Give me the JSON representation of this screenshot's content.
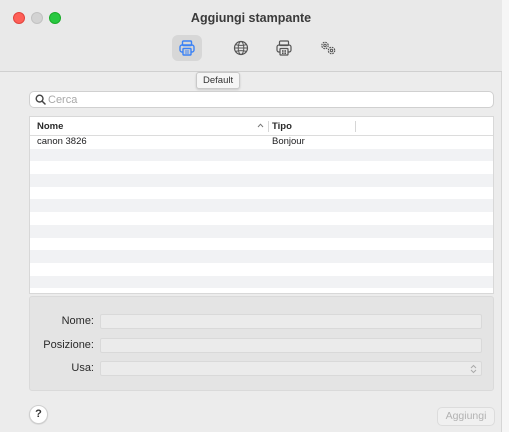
{
  "window": {
    "title": "Aggiungi stampante"
  },
  "toolbar": {
    "items": [
      {
        "name": "Default",
        "icon": "printer-icon",
        "active": true
      },
      {
        "name": "IP",
        "icon": "globe-icon",
        "active": false
      },
      {
        "name": "Windows",
        "icon": "windows-printer-icon",
        "active": false
      },
      {
        "name": "Avanzate",
        "icon": "gears-icon",
        "active": false
      }
    ],
    "tooltip": "Default"
  },
  "search": {
    "placeholder": "Cerca",
    "value": ""
  },
  "table": {
    "columns": [
      "Nome",
      "Tipo"
    ],
    "sort": {
      "column": "Nome",
      "direction": "ascending"
    },
    "rows": [
      {
        "name": "canon 3826",
        "type": "Bonjour"
      }
    ]
  },
  "details": {
    "name_label": "Nome:",
    "location_label": "Posizione:",
    "use_label": "Usa:",
    "name_value": "",
    "location_value": "",
    "use_value": ""
  },
  "footer": {
    "help_label": "?",
    "add_label": "Aggiungi"
  },
  "colors": {
    "accent": "#3b82f6",
    "close": "#fe5f57",
    "maximize": "#28c840"
  }
}
